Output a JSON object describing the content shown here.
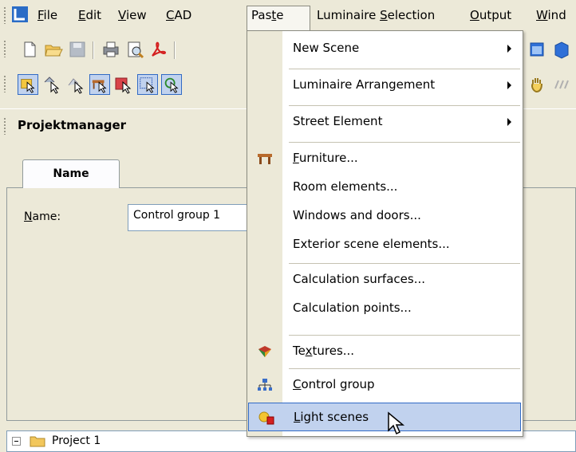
{
  "menubar": {
    "items": [
      {
        "label": "File",
        "accel": "F",
        "rest": "ile"
      },
      {
        "label": "Edit",
        "accel": "E",
        "rest": "dit"
      },
      {
        "label": "View",
        "accel": "V",
        "rest": "iew"
      },
      {
        "label": "CAD",
        "accel": "C",
        "rest": "AD"
      },
      {
        "label": "Paste",
        "pre": "Pas",
        "accel": "t",
        "rest": "e"
      },
      {
        "label": "Luminaire Selection",
        "pre": "Luminaire ",
        "accel": "S",
        "rest": "election"
      },
      {
        "label": "Output",
        "accel": "O",
        "rest": "utput"
      },
      {
        "label": "Wind",
        "accel": "W",
        "rest": "ind"
      }
    ]
  },
  "panel": {
    "title": "Projektmanager",
    "tab": "Name",
    "name_label_accel": "N",
    "name_label_rest": "ame:",
    "name_value": "Control group 1"
  },
  "tree": {
    "root_label": "Project 1"
  },
  "paste_menu": {
    "items": [
      {
        "label": "New Scene",
        "submenu": true
      },
      {
        "label": "Luminaire Arrangement",
        "submenu": true
      },
      {
        "label": "Street Element",
        "submenu": true
      },
      {
        "label": "Furniture...",
        "accel": "F",
        "rest": "urniture...",
        "icon": "furniture-icon"
      },
      {
        "label": "Room elements..."
      },
      {
        "label": "Windows and doors..."
      },
      {
        "label": "Exterior scene elements..."
      },
      {
        "label": "Calculation surfaces..."
      },
      {
        "label": "Calculation points..."
      },
      {
        "label": "Textures...",
        "pre": "Te",
        "accel": "x",
        "rest": "tures...",
        "icon": "textures-icon"
      },
      {
        "label": "Control group",
        "accel": "C",
        "rest": "ontrol group",
        "icon": "control-group-icon"
      },
      {
        "label": "Light scenes",
        "accel": "L",
        "rest": "ight scenes",
        "icon": "light-scenes-icon",
        "highlighted": true
      }
    ]
  },
  "colors": {
    "menu_highlight": "#c1d2ee",
    "menu_highlight_border": "#316ac5",
    "chrome": "#ece9d8"
  }
}
